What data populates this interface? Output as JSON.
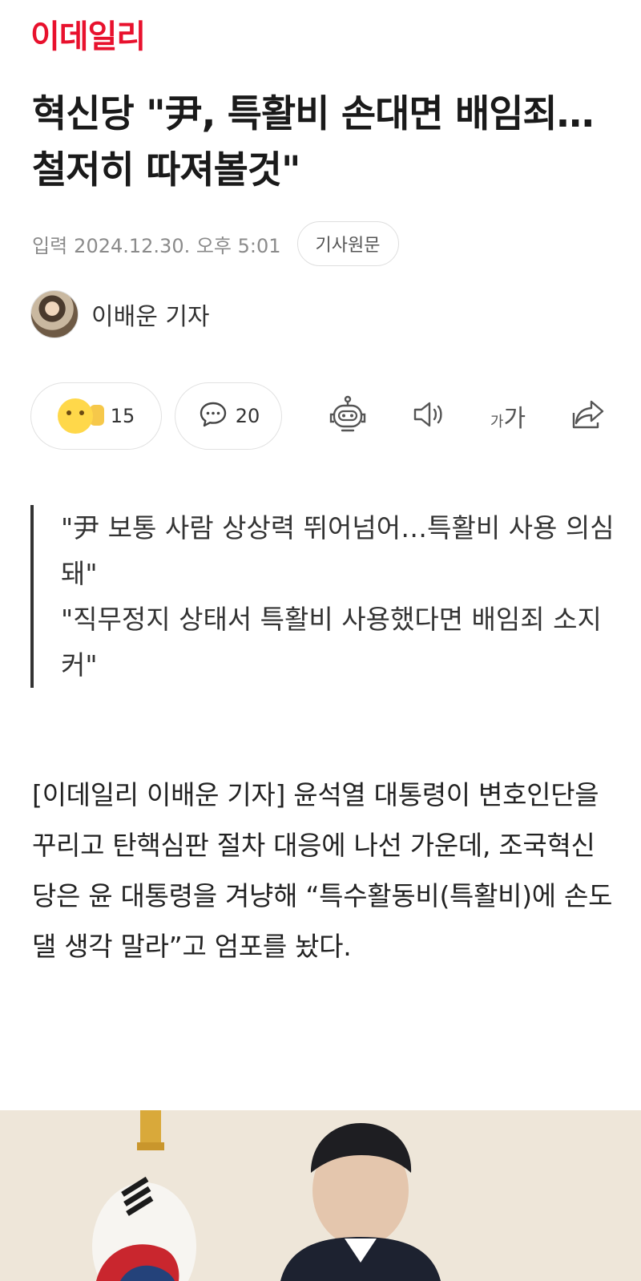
{
  "brand": {
    "logo_text": "이데일리",
    "accent": "#e8112d"
  },
  "article": {
    "title": "혁신당 \"尹, 특활비 손대면 배임죄…철저히 따져볼것\"",
    "date_label": "입력",
    "date": "2024.12.30. 오후 5:01",
    "original_button": "기사원문",
    "reporter": "이배운 기자"
  },
  "actions": {
    "reaction_count": "15",
    "comment_count": "20",
    "icons": [
      "emoji-reaction-icon",
      "comment-icon",
      "robot-summary-icon",
      "speaker-icon",
      "font-size-icon",
      "share-icon"
    ],
    "font_size_small": "가",
    "font_size_large": "가"
  },
  "subhead": {
    "lines": [
      "\"尹 보통 사람 상상력 뛰어넘어…특활비 사용 의심돼\"",
      "\"직무정지 상태서 특활비 사용했다면 배임죄 소지 커\""
    ]
  },
  "body": {
    "paragraph": "[이데일리 이배운 기자] 윤석열 대통령이 변호인단을 꾸리고 탄핵심판 절차 대응에 나선 가운데, 조국혁신당은 윤 대통령을 겨냥해 “특수활동비(특활비)에 손도 댈 생각 말라”고 엄포를 놨다."
  }
}
